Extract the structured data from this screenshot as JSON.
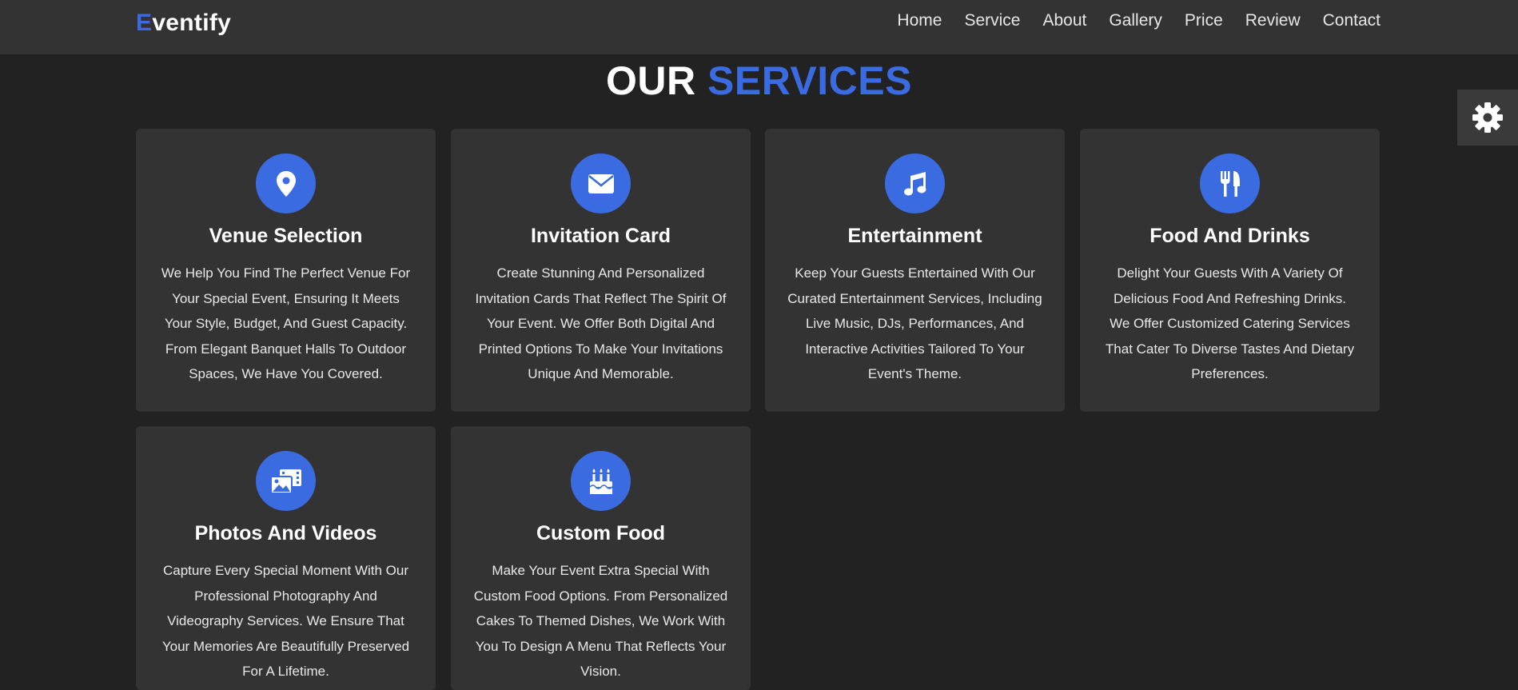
{
  "navbar": {
    "logo_first": "E",
    "logo_rest": "ventify",
    "links": [
      "Home",
      "Service",
      "About",
      "Gallery",
      "Price",
      "Review",
      "Contact"
    ]
  },
  "section": {
    "title_plain": "OUR",
    "title_accent": "SERVICES"
  },
  "services": [
    {
      "icon": "map-marker-icon",
      "title": "Venue Selection",
      "text": "We Help You Find The Perfect Venue For Your Special Event, Ensuring It Meets Your Style, Budget, And Guest Capacity. From Elegant Banquet Halls To Outdoor Spaces, We Have You Covered."
    },
    {
      "icon": "envelope-icon",
      "title": "Invitation Card",
      "text": "Create Stunning And Personalized Invitation Cards That Reflect The Spirit Of Your Event. We Offer Both Digital And Printed Options To Make Your Invitations Unique And Memorable."
    },
    {
      "icon": "music-note-icon",
      "title": "Entertainment",
      "text": "Keep Your Guests Entertained With Our Curated Entertainment Services, Including Live Music, DJs, Performances, And Interactive Activities Tailored To Your Event's Theme."
    },
    {
      "icon": "utensils-icon",
      "title": "Food And Drinks",
      "text": "Delight Your Guests With A Variety Of Delicious Food And Refreshing Drinks. We Offer Customized Catering Services That Cater To Diverse Tastes And Dietary Preferences."
    },
    {
      "icon": "photo-video-icon",
      "title": "Photos And Videos",
      "text": "Capture Every Special Moment With Our Professional Photography And Videography Services. We Ensure That Your Memories Are Beautifully Preserved For A Lifetime."
    },
    {
      "icon": "birthday-cake-icon",
      "title": "Custom Food",
      "text": "Make Your Event Extra Special With Custom Food Options. From Personalized Cakes To Themed Dishes, We Work With You To Design A Menu That Reflects Your Vision."
    }
  ],
  "settings": {
    "icon": "gear-icon"
  },
  "colors": {
    "accent": "#3a6be0",
    "background": "#222222",
    "card": "#333333"
  }
}
